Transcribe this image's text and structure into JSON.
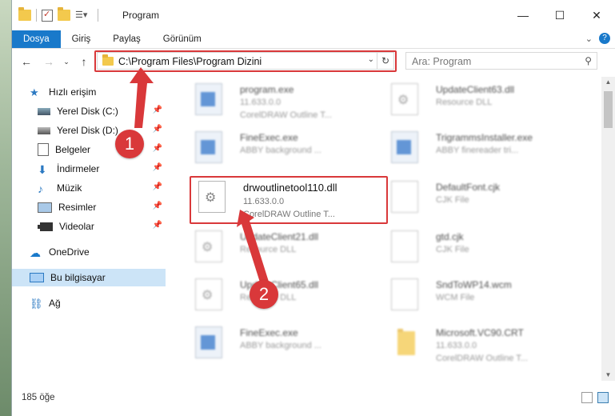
{
  "window": {
    "title": "Program",
    "controls": {
      "minimize": "—",
      "maximize": "☐",
      "close": "✕"
    }
  },
  "ribbon": {
    "tabs": [
      "Dosya",
      "Giriş",
      "Paylaş",
      "Görünüm"
    ]
  },
  "address": {
    "path": "C:\\Program Files\\Program Dizini",
    "search_placeholder": "Ara: Program"
  },
  "sidebar": {
    "quick_access": "Hızlı erişim",
    "items": [
      {
        "label": "Yerel Disk (C:)",
        "icon": "drive-icon"
      },
      {
        "label": "Yerel Disk (D:)",
        "icon": "drive-icon"
      },
      {
        "label": "Belgeler",
        "icon": "documents-icon"
      },
      {
        "label": "İndirmeler",
        "icon": "downloads-icon"
      },
      {
        "label": "Müzik",
        "icon": "music-icon"
      },
      {
        "label": "Resimler",
        "icon": "pictures-icon"
      },
      {
        "label": "Videolar",
        "icon": "videos-icon"
      }
    ],
    "onedrive": "OneDrive",
    "this_pc": "Bu bilgisayar",
    "network": "Ağ"
  },
  "files": [
    {
      "name": "program.exe",
      "line1": "11.633.0.0",
      "line2": "CorelDRAW Outline T...",
      "icon": "exe-icon"
    },
    {
      "name": "UpdateClient63.dll",
      "line1": "Resource DLL",
      "line2": "",
      "icon": "dll-icon"
    },
    {
      "name": "FineExec.exe",
      "line1": "ABBY background ...",
      "line2": "",
      "icon": "exe-icon"
    },
    {
      "name": "TrigrammsInstaller.exe",
      "line1": "ABBY finereader tri...",
      "line2": "",
      "icon": "exe-icon"
    },
    {
      "name": "drwoutlinetool110.dll",
      "line1": "11.633.0.0",
      "line2": "CorelDRAW Outline T...",
      "icon": "dll-icon"
    },
    {
      "name": "DefaultFont.cjk",
      "line1": "CJK File",
      "line2": "",
      "icon": "file-icon"
    },
    {
      "name": "UpdateClient21.dll",
      "line1": "Resource DLL",
      "line2": "",
      "icon": "dll-icon"
    },
    {
      "name": "gtd.cjk",
      "line1": "CJK File",
      "line2": "",
      "icon": "file-icon"
    },
    {
      "name": "UpdateClient65.dll",
      "line1": "Resource DLL",
      "line2": "",
      "icon": "dll-icon"
    },
    {
      "name": "SndToWP14.wcm",
      "line1": "WCM File",
      "line2": "",
      "icon": "file-icon"
    },
    {
      "name": "FineExec.exe",
      "line1": "ABBY background ...",
      "line2": "",
      "icon": "exe-icon"
    },
    {
      "name": "Microsoft.VC90.CRT",
      "line1": "11.633.0.0",
      "line2": "CorelDRAW Outline T...",
      "icon": "folder-icon"
    }
  ],
  "status": {
    "count": "185 öğe"
  },
  "annotations": {
    "step1": "1",
    "step2": "2",
    "color": "#d9383a"
  }
}
